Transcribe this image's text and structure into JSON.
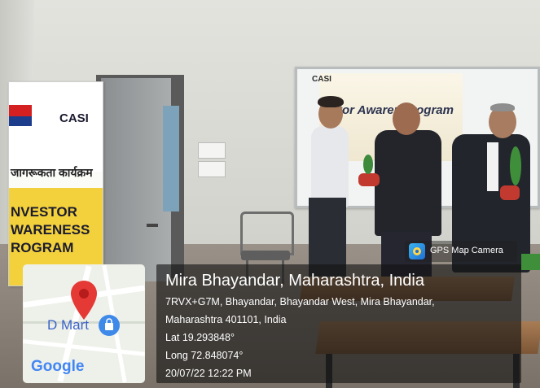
{
  "banner": {
    "org_short": "CASI",
    "hindi_title": "जागरूकता कार्यक्रम",
    "line1": "NVESTOR",
    "line2": "WARENESS",
    "line3": "ROGRAM"
  },
  "board": {
    "screen_label": "CASI",
    "title_text": "tor Awarene  rogram"
  },
  "gps_camera": {
    "badge_label": "GPS Map Camera",
    "location_title": "Mira Bhayandar, Maharashtra, India",
    "address_line1": "7RVX+G7M, Bhayandar, Bhayandar West, Mira Bhayandar,",
    "address_line2": "Maharashtra 401101, India",
    "latitude": "Lat 19.293848°",
    "longitude": "Long 72.848074°",
    "timestamp": "20/07/22 12:22 PM"
  },
  "map": {
    "place_label": "D Mart",
    "brand": "Google",
    "pin_icon": "map-pin-icon",
    "shop_icon": "shopping-bag-icon"
  },
  "colors": {
    "pin_red": "#e53935",
    "google_blue": "#4285f4",
    "banner_yellow": "#f3d13c"
  }
}
